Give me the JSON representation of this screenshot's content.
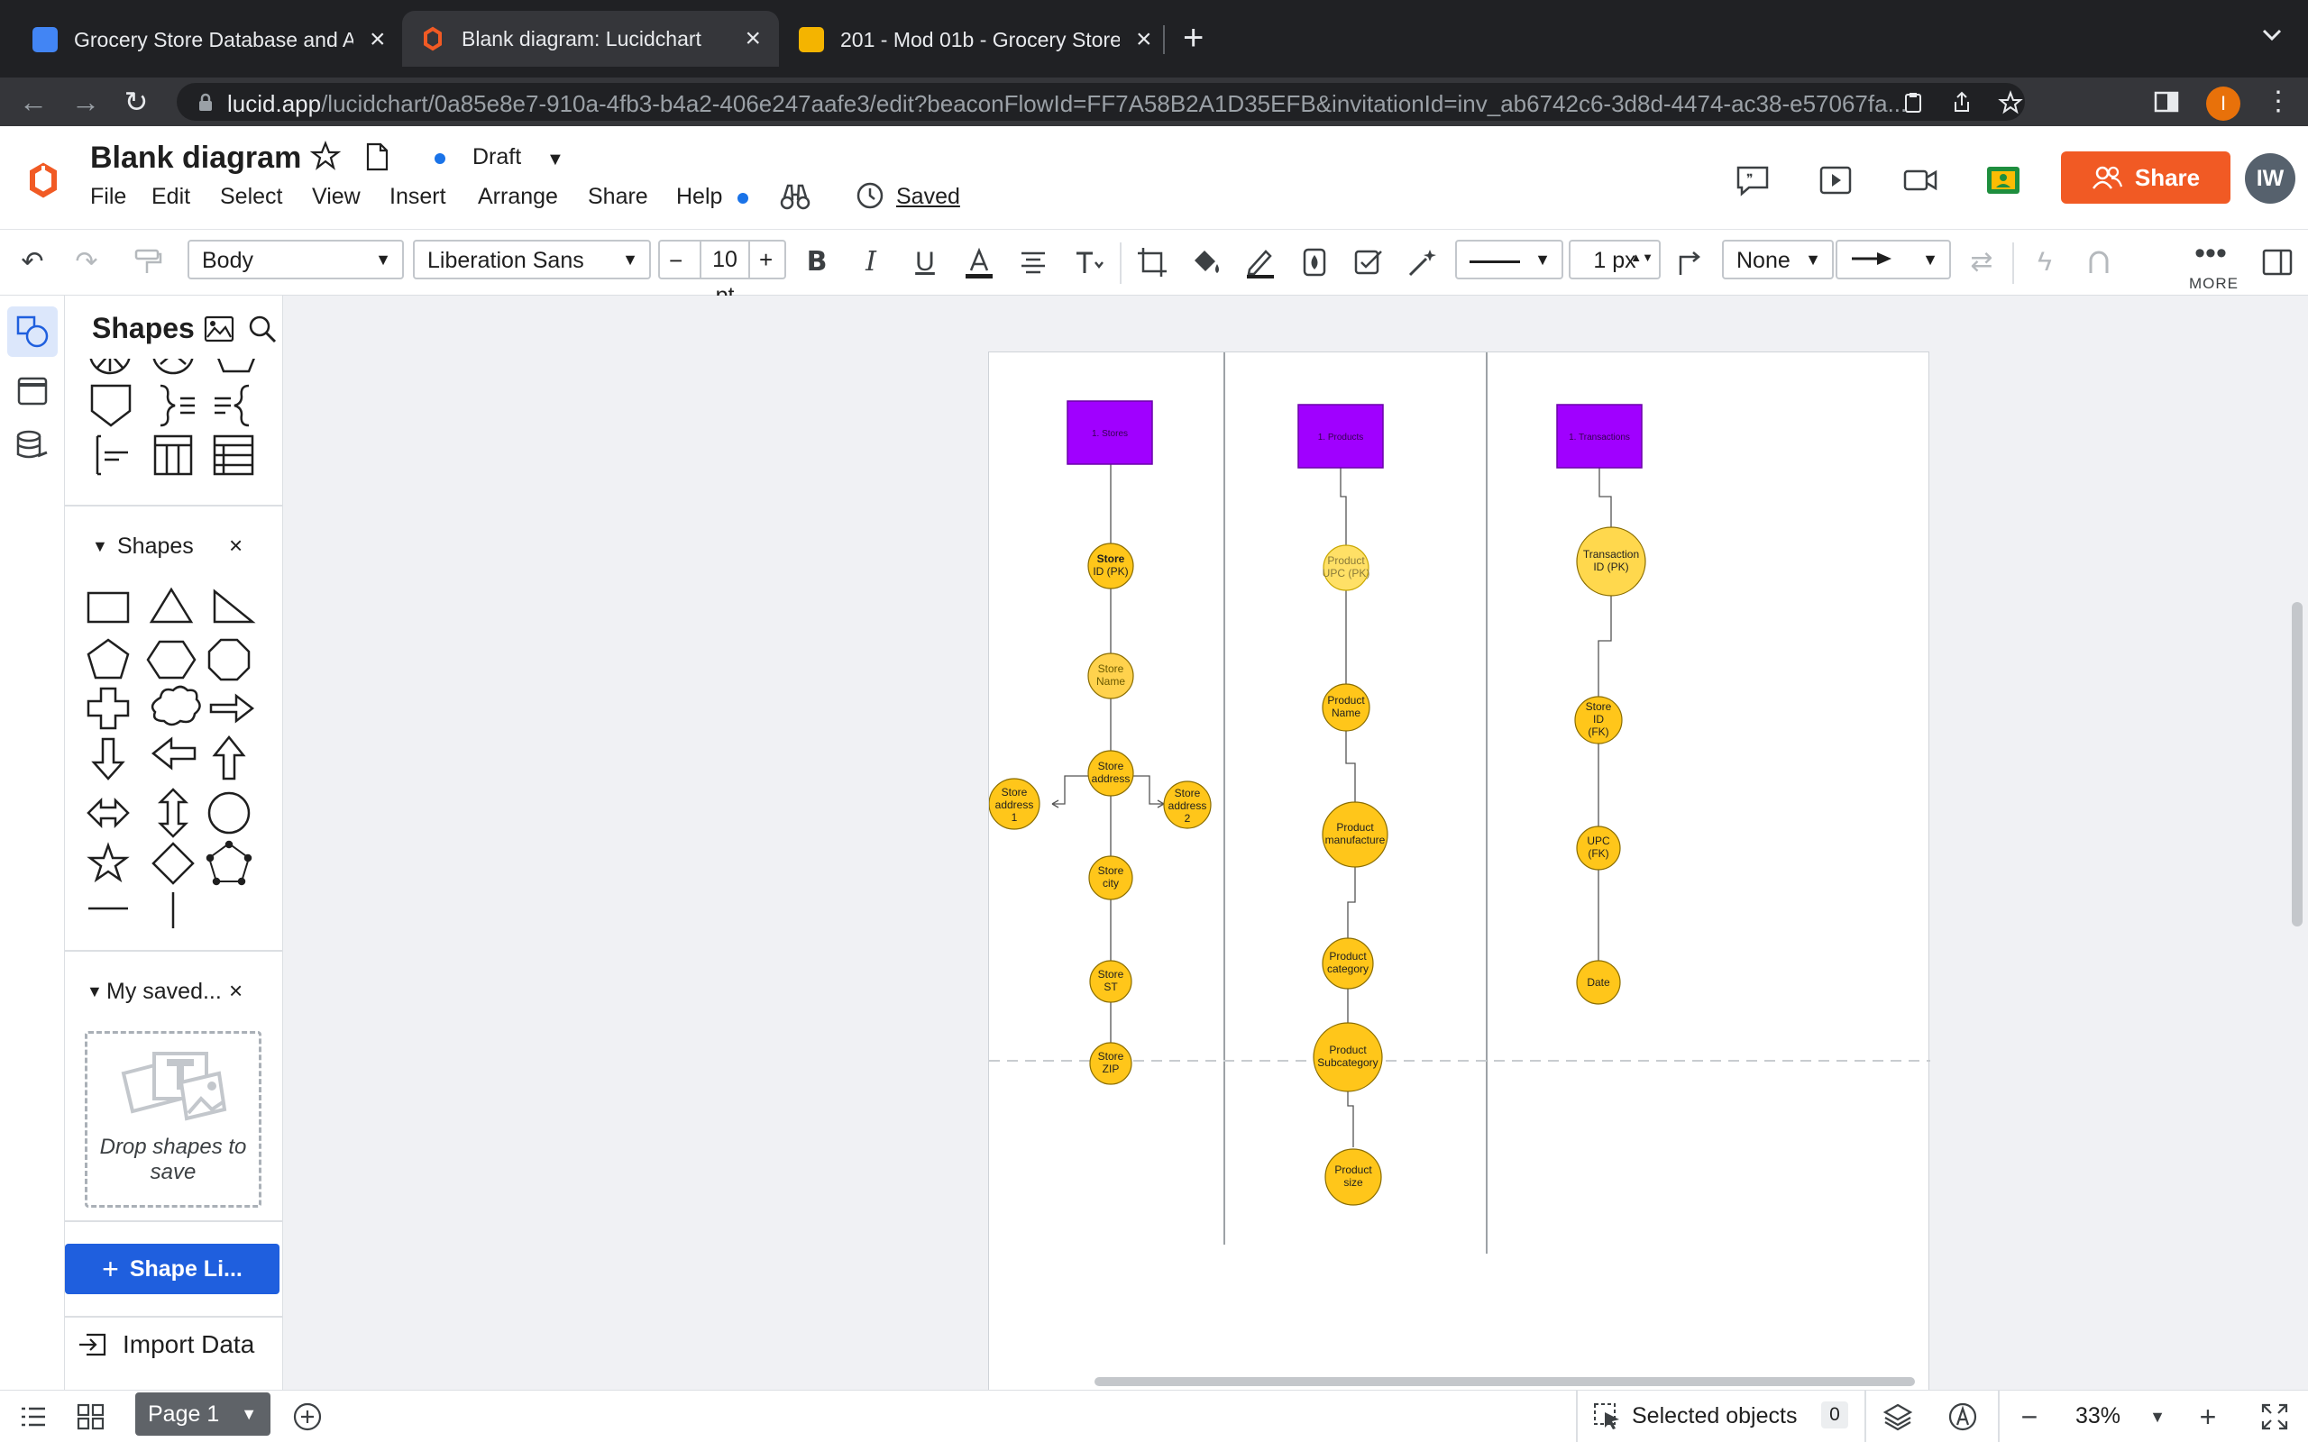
{
  "browser": {
    "tabs": [
      {
        "title": "Grocery Store Database and A",
        "icon": "docs-icon"
      },
      {
        "title": "Blank diagram: Lucidchart",
        "icon": "lucid-icon"
      },
      {
        "title": "201 - Mod 01b - Grocery Store",
        "icon": "slides-icon"
      }
    ],
    "url_host": "lucid.app",
    "url_path": "/lucidchart/0a85e8e7-910a-4fb3-b4a2-406e247aafe3/edit?beaconFlowId=FF7A58B2A1D35EFB&invitationId=inv_ab6742c6-3d8d-4474-ac38-e57067fa...",
    "profile_initial": "I"
  },
  "app": {
    "doc_title": "Blank diagram",
    "status": "Draft",
    "menus": [
      "File",
      "Edit",
      "Select",
      "View",
      "Insert",
      "Arrange",
      "Share",
      "Help"
    ],
    "saved_label": "Saved",
    "share_label": "Share",
    "avatar_initials": "IW",
    "accent": "#f15a24"
  },
  "toolbar": {
    "text_style": "Body",
    "font": "Liberation Sans",
    "font_size": "10 pt",
    "line_width": "1 px",
    "endpoint_start": "None",
    "more_label": "MORE"
  },
  "panel": {
    "title": "Shapes",
    "section_shapes": "Shapes",
    "section_saved": "My saved...",
    "drop_hint": "Drop shapes to save",
    "shape_library_btn": "Shape Li...",
    "import_data": "Import Data"
  },
  "diagram": {
    "tables": [
      {
        "label": "1. Stores",
        "color": "#a000ff"
      },
      {
        "label": "1. Products",
        "color": "#a000ff"
      },
      {
        "label": "1. Transactions",
        "color": "#a000ff"
      }
    ],
    "attribute_color": "#ffc61a",
    "stores": [
      "Store ID (PK)",
      "Store Name",
      "Store address",
      "Store address 1",
      "Store address 2",
      "Store city",
      "Store ST",
      "Store ZIP"
    ],
    "products": [
      "Product UPC (PK)",
      "Product Name",
      "Product manufacture",
      "Product category",
      "Product Subcategory",
      "Product size"
    ],
    "transactions": [
      "Transaction ID (PK)",
      "Store ID (FK)",
      "UPC (FK)",
      "Date"
    ]
  },
  "bottom": {
    "page_label": "Page 1",
    "selected_label": "Selected objects",
    "selected_count": "0",
    "zoom": "33%"
  }
}
